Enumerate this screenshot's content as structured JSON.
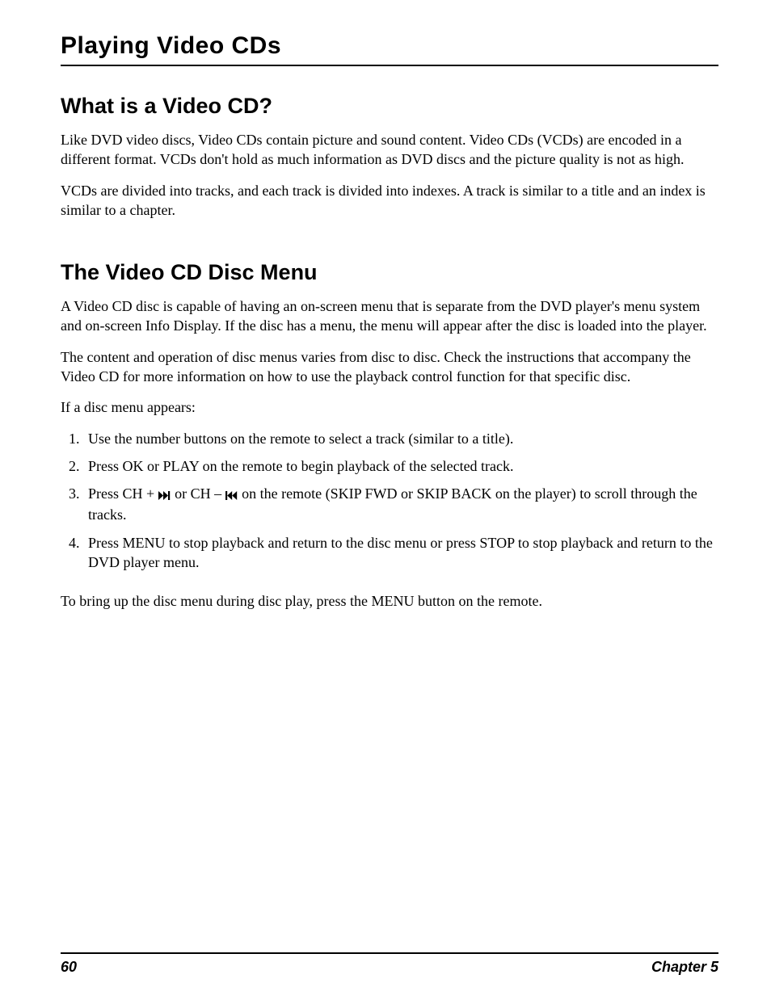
{
  "chapter_title": "Playing Video CDs",
  "section1": {
    "heading": "What is a Video CD?",
    "p1": "Like DVD video discs, Video CDs contain picture and sound content. Video CDs (VCDs) are encoded in a different format. VCDs don't hold as much information as DVD discs and the picture quality is not as high.",
    "p2": "VCDs are divided into tracks, and each track is divided into indexes. A track is similar to a title and an index is similar to a chapter."
  },
  "section2": {
    "heading": "The Video CD Disc Menu",
    "p1": "A Video CD disc is capable of having an on-screen menu that is separate from the DVD player's menu system and on-screen Info Display. If the disc has a menu, the menu will appear after the disc is loaded into the player.",
    "p2": "The content and operation of disc menus varies from disc to disc. Check the instructions that accompany the Video CD for more information on how to use the playback control function for that specific disc.",
    "p3": "If a disc menu appears:",
    "steps": {
      "s1": "Use the number buttons on the remote to select a track (similar to a title).",
      "s2": "Press OK or PLAY on the remote to begin playback of the selected track.",
      "s3_a": "Press CH + ",
      "s3_b": "  or CH – ",
      "s3_c": "  on the remote (SKIP FWD or SKIP BACK on the player) to scroll through the tracks.",
      "s4": "Press MENU to stop playback and return to the disc menu or press STOP to stop playback and return to the DVD player menu."
    },
    "p4": "To bring up the disc menu during disc play, press the MENU button on the remote."
  },
  "footer": {
    "page_number": "60",
    "chapter_label": "Chapter 5"
  }
}
